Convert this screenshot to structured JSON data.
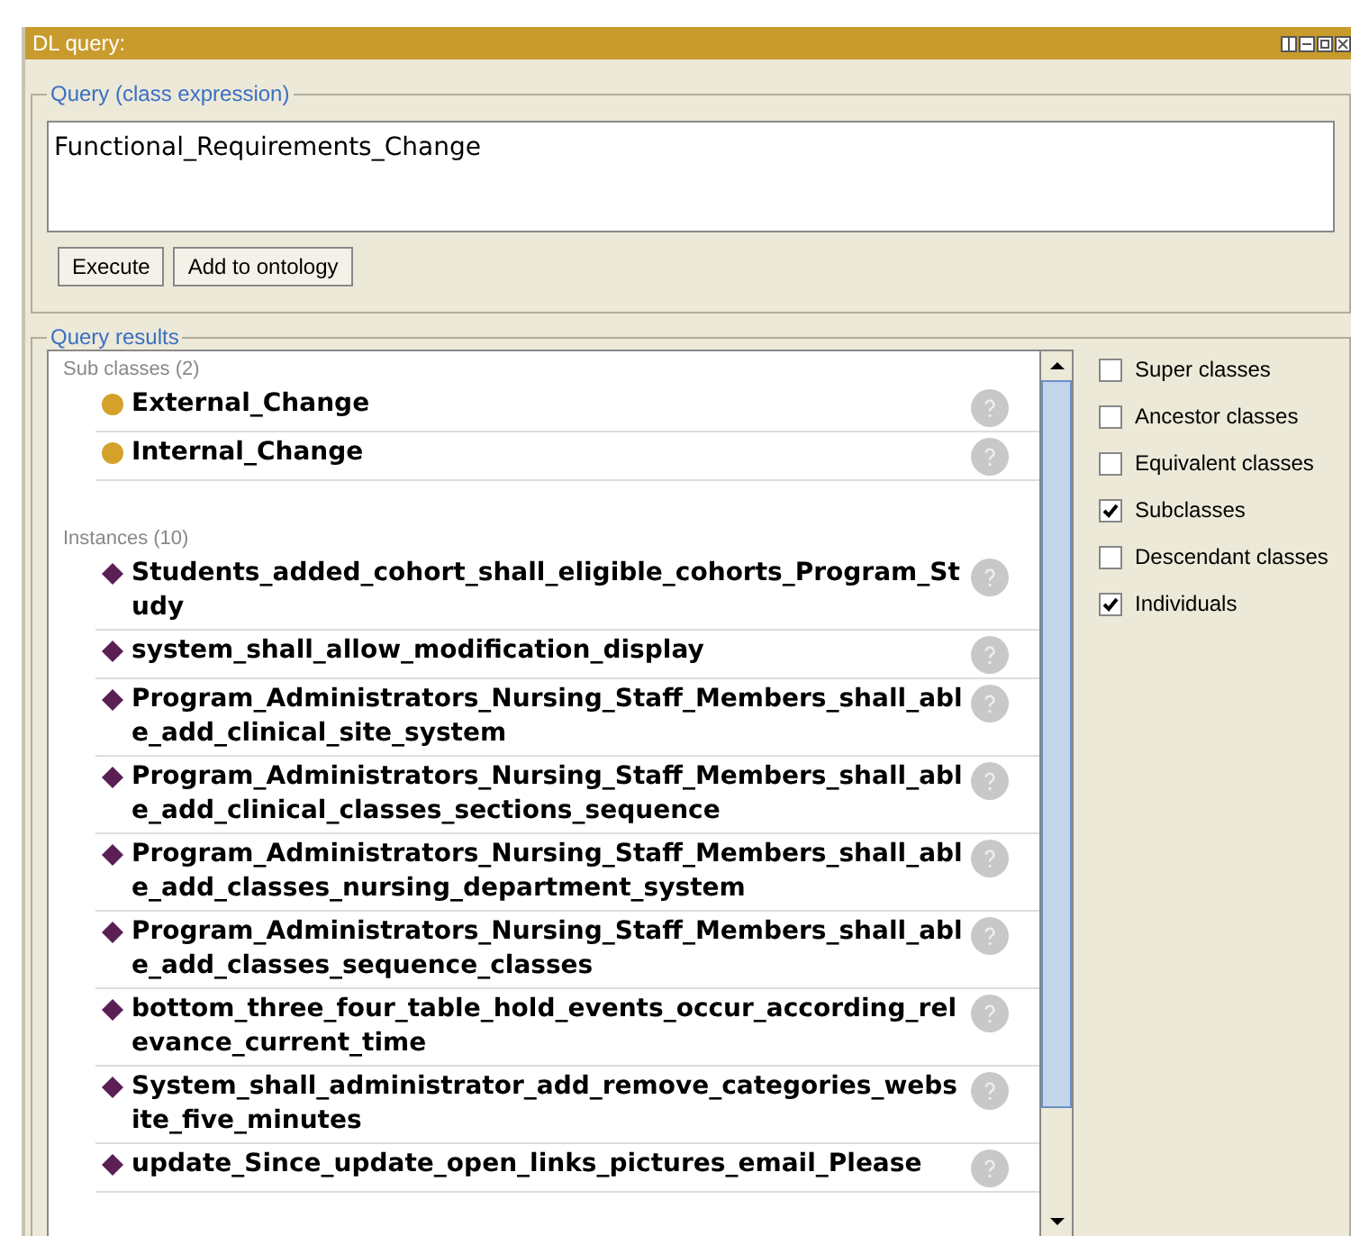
{
  "window": {
    "title": "DL query:"
  },
  "query": {
    "legend": "Query (class expression)",
    "value": "Functional_Requirements_Change",
    "buttons": [
      "Execute",
      "Add to ontology"
    ]
  },
  "results": {
    "legend": "Query results",
    "sections": [
      {
        "heading": "Sub classes (2)",
        "kind": "class",
        "items": [
          "External_Change",
          "Internal_Change"
        ]
      },
      {
        "heading": "Instances (10)",
        "kind": "individual",
        "items": [
          "Students_added_cohort_shall_eligible_cohorts_Program_Study",
          "system_shall_allow_modification_display",
          "Program_Administrators_Nursing_Staff_Members_shall_able_add_clinical_site_system",
          "Program_Administrators_Nursing_Staff_Members_shall_able_add_clinical_classes_sections_sequence",
          "Program_Administrators_Nursing_Staff_Members_shall_able_add_classes_nursing_department_system",
          "Program_Administrators_Nursing_Staff_Members_shall_able_add_classes_sequence_classes",
          "bottom_three_four_table_hold_events_occur_according_relevance_current_time",
          "System_shall_administrator_add_remove_categories_website_five_minutes",
          "update_Since_update_open_links_pictures_email_Please"
        ]
      }
    ],
    "options": [
      {
        "label": "Super classes",
        "checked": false
      },
      {
        "label": "Ancestor classes",
        "checked": false
      },
      {
        "label": "Equivalent classes",
        "checked": false
      },
      {
        "label": "Subclasses",
        "checked": true
      },
      {
        "label": "Descendant classes",
        "checked": false
      },
      {
        "label": "Individuals",
        "checked": true
      }
    ]
  }
}
